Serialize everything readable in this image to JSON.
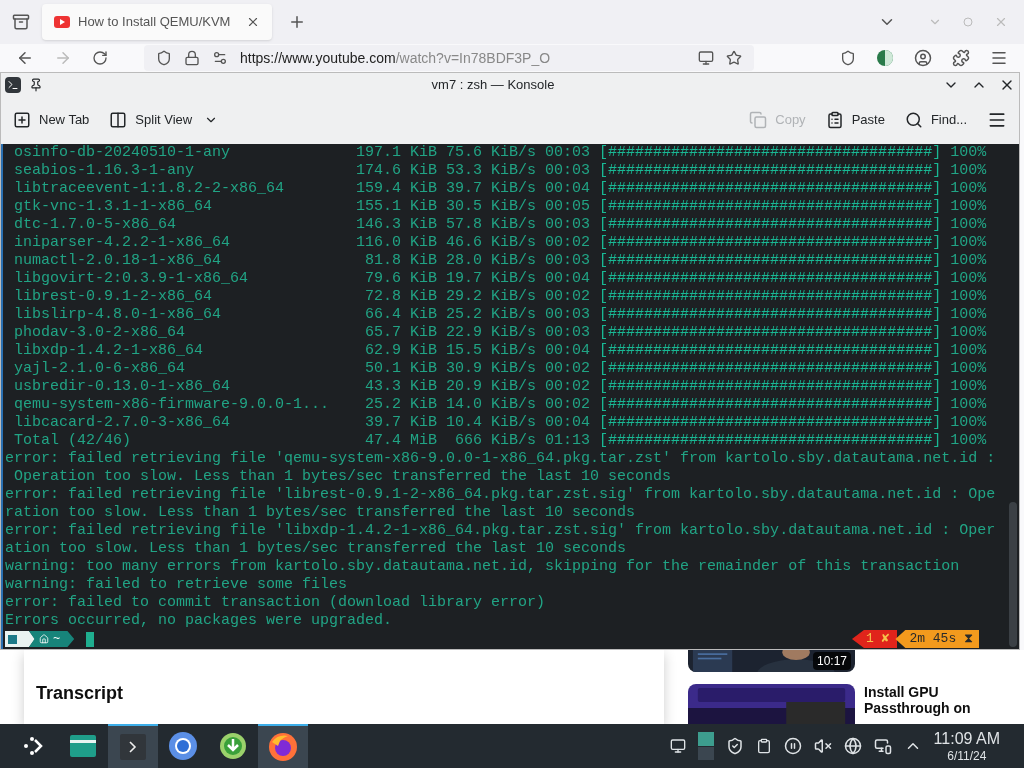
{
  "browser": {
    "tab": {
      "title": "How to Install QEMU/KVM"
    },
    "url_host": "https://www.youtube.com",
    "url_path": "/watch?v=In78BDF3P_O"
  },
  "konsole": {
    "title": "vm7 : zsh — Konsole",
    "toolbar_left": [
      {
        "kind": "newtab",
        "label": "New Tab"
      },
      {
        "kind": "split",
        "label": "Split View"
      }
    ],
    "toolbar_right": [
      {
        "kind": "copy",
        "label": "Copy",
        "disabled": true
      },
      {
        "kind": "paste",
        "label": "Paste",
        "disabled": false
      },
      {
        "kind": "find",
        "label": "Find...",
        "disabled": false
      }
    ]
  },
  "terminal": {
    "downloads": [
      {
        "name": "osinfo-db-20240510-1-any",
        "size": "197.1 KiB",
        "rate": "75.6 KiB/s",
        "time": "00:03",
        "bar": "[####################################]",
        "percent": "100%"
      },
      {
        "name": "seabios-1.16.3-1-any",
        "size": "174.6 KiB",
        "rate": "53.3 KiB/s",
        "time": "00:03",
        "bar": "[####################################]",
        "percent": "100%"
      },
      {
        "name": "libtraceevent-1:1.8.2-2-x86_64",
        "size": "159.4 KiB",
        "rate": "39.7 KiB/s",
        "time": "00:04",
        "bar": "[####################################]",
        "percent": "100%"
      },
      {
        "name": "gtk-vnc-1.3.1-1-x86_64",
        "size": "155.1 KiB",
        "rate": "30.5 KiB/s",
        "time": "00:05",
        "bar": "[####################################]",
        "percent": "100%"
      },
      {
        "name": "dtc-1.7.0-5-x86_64",
        "size": "146.3 KiB",
        "rate": "57.8 KiB/s",
        "time": "00:03",
        "bar": "[####################################]",
        "percent": "100%"
      },
      {
        "name": "iniparser-4.2.2-1-x86_64",
        "size": "116.0 KiB",
        "rate": "46.6 KiB/s",
        "time": "00:02",
        "bar": "[####################################]",
        "percent": "100%"
      },
      {
        "name": "numactl-2.0.18-1-x86_64",
        "size": "81.8 KiB",
        "rate": "28.0 KiB/s",
        "time": "00:03",
        "bar": "[####################################]",
        "percent": "100%"
      },
      {
        "name": "libgovirt-2:0.3.9-1-x86_64",
        "size": "79.6 KiB",
        "rate": "19.7 KiB/s",
        "time": "00:04",
        "bar": "[####################################]",
        "percent": "100%"
      },
      {
        "name": "librest-0.9.1-2-x86_64",
        "size": "72.8 KiB",
        "rate": "29.2 KiB/s",
        "time": "00:02",
        "bar": "[####################################]",
        "percent": "100%"
      },
      {
        "name": "libslirp-4.8.0-1-x86_64",
        "size": "66.4 KiB",
        "rate": "25.2 KiB/s",
        "time": "00:03",
        "bar": "[####################################]",
        "percent": "100%"
      },
      {
        "name": "phodav-3.0-2-x86_64",
        "size": "65.7 KiB",
        "rate": "22.9 KiB/s",
        "time": "00:03",
        "bar": "[####################################]",
        "percent": "100%"
      },
      {
        "name": "libxdp-1.4.2-1-x86_64",
        "size": "62.9 KiB",
        "rate": "15.5 KiB/s",
        "time": "00:04",
        "bar": "[####################################]",
        "percent": "100%"
      },
      {
        "name": "yajl-2.1.0-6-x86_64",
        "size": "50.1 KiB",
        "rate": "30.9 KiB/s",
        "time": "00:02",
        "bar": "[####################################]",
        "percent": "100%"
      },
      {
        "name": "usbredir-0.13.0-1-x86_64",
        "size": "43.3 KiB",
        "rate": "20.9 KiB/s",
        "time": "00:02",
        "bar": "[####################################]",
        "percent": "100%"
      },
      {
        "name": "qemu-system-x86-firmware-9.0.0-1...",
        "size": "25.2 KiB",
        "rate": "14.0 KiB/s",
        "time": "00:02",
        "bar": "[####################################]",
        "percent": "100%"
      },
      {
        "name": "libcacard-2.7.0-3-x86_64",
        "size": "39.7 KiB",
        "rate": "10.4 KiB/s",
        "time": "00:04",
        "bar": "[####################################]",
        "percent": "100%"
      },
      {
        "name": "Total (42/46)",
        "size": "47.4 MiB",
        "rate": "666 KiB/s",
        "time": "01:13",
        "bar": "[####################################]",
        "percent": "100%"
      }
    ],
    "log": [
      "error: failed retrieving file 'qemu-system-x86-9.0.0-1-x86_64.pkg.tar.zst' from kartolo.sby.datautama.net.id :",
      " Operation too slow. Less than 1 bytes/sec transferred the last 10 seconds",
      "error: failed retrieving file 'librest-0.9.1-2-x86_64.pkg.tar.zst.sig' from kartolo.sby.datautama.net.id : Ope",
      "ration too slow. Less than 1 bytes/sec transferred the last 10 seconds",
      "error: failed retrieving file 'libxdp-1.4.2-1-x86_64.pkg.tar.zst.sig' from kartolo.sby.datautama.net.id : Oper",
      "ation too slow. Less than 1 bytes/sec transferred the last 10 seconds",
      "warning: too many errors from kartolo.sby.datautama.net.id, skipping for the remainder of this transaction",
      "warning: failed to retrieve some files",
      "error: failed to commit transaction (download library error)",
      "Errors occurred, no packages were upgraded."
    ],
    "prompt": {
      "dir": "~",
      "status": "1 ✘",
      "duration": "2m 45s ⧗"
    }
  },
  "page": {
    "transcript_heading": "Transcript",
    "thumb_duration": "10:17",
    "video_title": "Install GPU Passthrough on"
  },
  "taskbar": {
    "apps": [
      {
        "kind": "launcher",
        "active": false
      },
      {
        "kind": "files",
        "active": false
      },
      {
        "kind": "terminal",
        "active": true
      },
      {
        "kind": "chromium",
        "active": false
      },
      {
        "kind": "downloader",
        "active": false
      },
      {
        "kind": "firefox",
        "active": true
      }
    ],
    "time": "11:09 AM",
    "date": "6/11/24"
  }
}
